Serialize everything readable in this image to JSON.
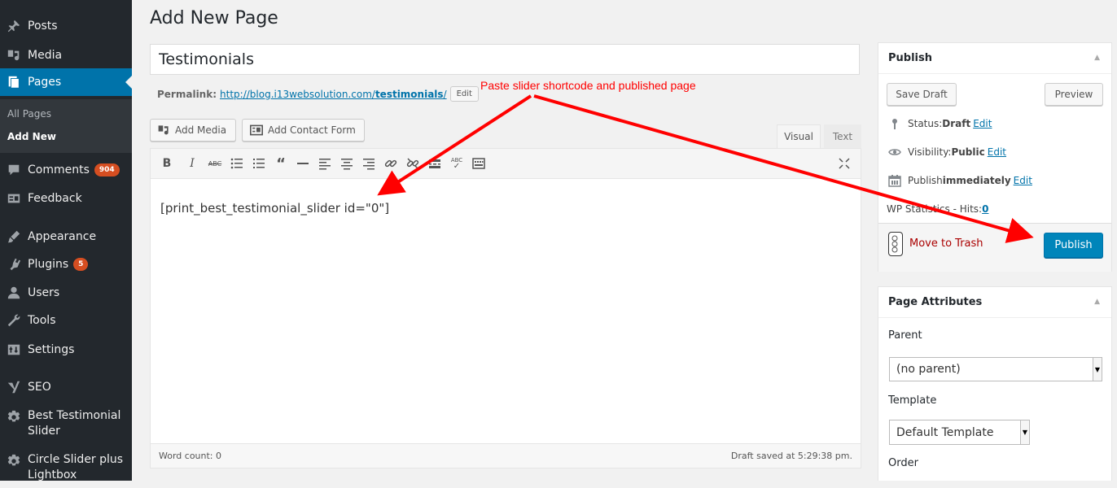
{
  "sidebar": {
    "items": {
      "posts": "Posts",
      "media": "Media",
      "pages": "Pages",
      "comments": "Comments",
      "comments_badge": "904",
      "feedback": "Feedback",
      "appearance": "Appearance",
      "plugins": "Plugins",
      "plugins_badge": "5",
      "users": "Users",
      "tools": "Tools",
      "settings": "Settings",
      "seo": "SEO",
      "best_testimonial_1": "Best Testimonial",
      "best_testimonial_2": "Slider",
      "circle_slider_1": "Circle Slider plus",
      "circle_slider_2": "Lightbox"
    },
    "submenu": {
      "all_pages": "All Pages",
      "add_new": "Add New"
    }
  },
  "main": {
    "page_title": "Add New Page",
    "title_value": "Testimonials",
    "permalink_label": "Permalink:",
    "permalink_base": "http://blog.i13websolution.com/",
    "permalink_slug": "testimonials",
    "permalink_end": "/",
    "permalink_edit": "Edit",
    "add_media": "Add Media",
    "add_contact_form": "Add Contact Form",
    "tab_visual": "Visual",
    "tab_text": "Text",
    "editor_content": "[print_best_testimonial_slider id=\"0\"]",
    "word_count": "Word count: 0",
    "draft_saved": "Draft saved at 5:29:38 pm.",
    "annotation": "Paste slider shortcode and published page"
  },
  "publish": {
    "title": "Publish",
    "save_draft": "Save Draft",
    "preview": "Preview",
    "status_label": "Status: ",
    "status_value": "Draft",
    "status_edit": "Edit",
    "visibility_label": "Visibility: ",
    "visibility_value": "Public",
    "visibility_edit": "Edit",
    "schedule_label": "Publish ",
    "schedule_value": "immediately",
    "schedule_edit": "Edit",
    "stats_label": "WP Statistics - Hits: ",
    "stats_value": "0",
    "trash": "Move to Trash",
    "publish_button": "Publish"
  },
  "attributes": {
    "title": "Page Attributes",
    "parent_label": "Parent",
    "parent_value": "(no parent)",
    "template_label": "Template",
    "template_value": "Default Template",
    "order_label": "Order"
  },
  "colors": {
    "sidebar_bg": "#23282d",
    "accent": "#0073aa",
    "publish_button": "#0085ba",
    "badge": "#d54e21",
    "annotation": "#ff0000"
  }
}
